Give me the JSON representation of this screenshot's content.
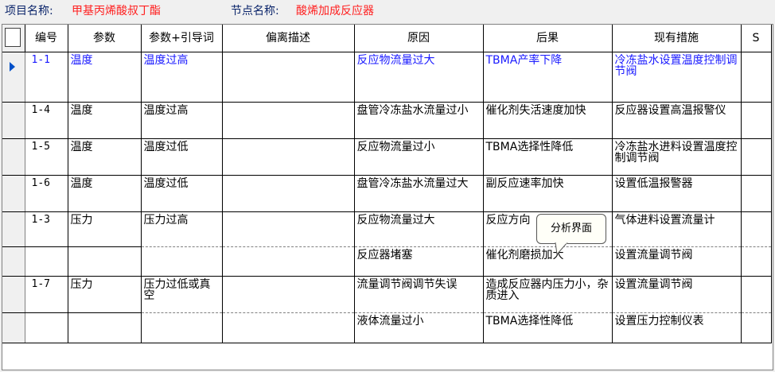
{
  "header": {
    "project_label": "项目名称:",
    "project_value": "甲基丙烯酸叔丁酯",
    "node_label": "节点名称:",
    "node_value": "酸烯加成反应器"
  },
  "columns": [
    "编号",
    "参数",
    "参数+引导词",
    "偏离描述",
    "原因",
    "后果",
    "现有措施",
    "S"
  ],
  "rows": [
    {
      "id": "1-1",
      "param": "温度",
      "guide": "温度过高",
      "desc": "",
      "cause": "反应物流量过大",
      "consequence": "TBMA产率下降",
      "measure": "冷冻盐水设置温度控制调节阀",
      "s": ""
    },
    {
      "id": "1-4",
      "param": "温度",
      "guide": "温度过高",
      "desc": "",
      "cause": "盘管冷冻盐水流量过小",
      "consequence": "催化剂失活速度加快",
      "measure": "反应器设置高温报警仪",
      "s": ""
    },
    {
      "id": "1-5",
      "param": "温度",
      "guide": "温度过低",
      "desc": "",
      "cause": "反应物流量过小",
      "consequence": "TBMA选择性降低",
      "measure": "冷冻盐水进料设置温度控制调节阀",
      "s": ""
    },
    {
      "id": "1-6",
      "param": "温度",
      "guide": "温度过低",
      "desc": "",
      "cause": "盘管冷冻盐水流量过大",
      "consequence": "副反应速率加快",
      "measure": "设置低温报警器",
      "s": ""
    },
    {
      "id": "1-3",
      "param": "压力",
      "guide": "压力过高",
      "desc": "",
      "cause": "反应物流量过大",
      "consequence": "反应方向",
      "measure": "气体进料设置流量计",
      "s": ""
    },
    {
      "id": "",
      "param": "",
      "guide": "",
      "desc": "",
      "cause": "反应器堵塞",
      "consequence": "催化剂磨损加大",
      "measure": "设置流量调节阀",
      "s": ""
    },
    {
      "id": "1-7",
      "param": "压力",
      "guide": "压力过低或真空",
      "desc": "",
      "cause": "流量调节阀调节失误",
      "consequence": "造成反应器内压力小，杂质进入",
      "measure": "设置流量调节阀",
      "s": ""
    },
    {
      "id": "",
      "param": "",
      "guide": "",
      "desc": "",
      "cause": "液体流量过小",
      "consequence": "TBMA选择性降低",
      "measure": "设置压力控制仪表",
      "s": ""
    }
  ],
  "tooltip": "分析界面",
  "colors": {
    "selected_text": "#1a1aff",
    "header_value": "#ff2020",
    "header_label": "#0a246a",
    "indicator": "#0050c8"
  }
}
